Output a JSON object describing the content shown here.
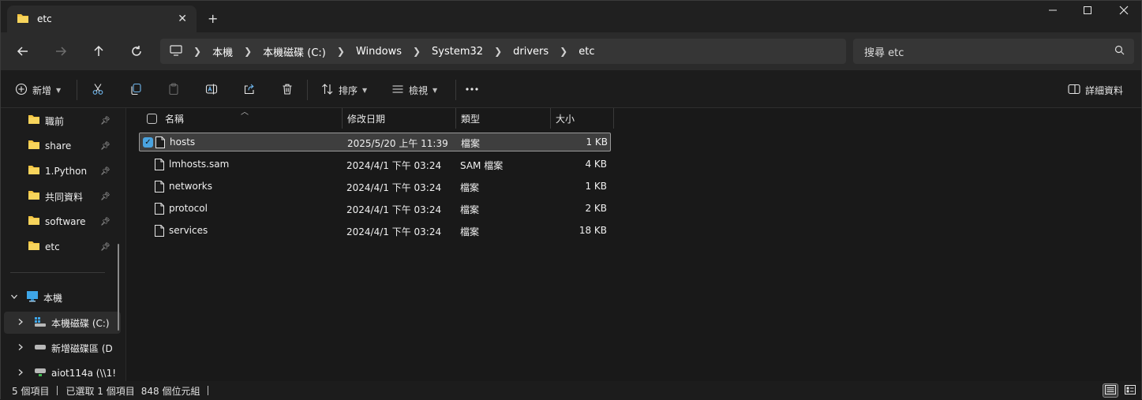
{
  "window": {
    "tab_label": "etc",
    "new_tab_glyph": "+",
    "close_tab_glyph": "✕"
  },
  "navigation": {
    "breadcrumbs": [
      "本機",
      "本機磁碟 (C:)",
      "Windows",
      "System32",
      "drivers",
      "etc"
    ],
    "search_placeholder": "搜尋 etc"
  },
  "command_bar": {
    "new_label": "新增",
    "sort_label": "排序",
    "view_label": "檢視",
    "details_label": "詳細資料"
  },
  "sidebar": {
    "pinned": [
      {
        "label": "職前",
        "icon": "folder-icon",
        "pinned": true
      },
      {
        "label": "share",
        "icon": "folder-icon",
        "pinned": true
      },
      {
        "label": "1.Python",
        "icon": "folder-icon",
        "pinned": true
      },
      {
        "label": "共同資料",
        "icon": "folder-icon",
        "pinned": true
      },
      {
        "label": "software",
        "icon": "folder-icon",
        "pinned": true
      },
      {
        "label": "etc",
        "icon": "folder-icon",
        "pinned": true
      }
    ],
    "this_pc": {
      "label": "本機",
      "expanded": true
    },
    "drives": [
      {
        "label": "本機磁碟 (C:)",
        "selected": true
      },
      {
        "label": "新增磁碟區 (D"
      },
      {
        "label": "aiot114a (\\\\1!"
      }
    ]
  },
  "file_list": {
    "columns": {
      "name": "名稱",
      "modified": "修改日期",
      "type": "類型",
      "size": "大小"
    },
    "rows": [
      {
        "name": "hosts",
        "modified": "2025/5/20 上午 11:39",
        "type": "檔案",
        "size": "1 KB",
        "selected": true
      },
      {
        "name": "lmhosts.sam",
        "modified": "2024/4/1 下午 03:24",
        "type": "SAM 檔案",
        "size": "4 KB",
        "selected": false
      },
      {
        "name": "networks",
        "modified": "2024/4/1 下午 03:24",
        "type": "檔案",
        "size": "1 KB",
        "selected": false
      },
      {
        "name": "protocol",
        "modified": "2024/4/1 下午 03:24",
        "type": "檔案",
        "size": "2 KB",
        "selected": false
      },
      {
        "name": "services",
        "modified": "2024/4/1 下午 03:24",
        "type": "檔案",
        "size": "18 KB",
        "selected": false
      }
    ]
  },
  "status_bar": {
    "item_count": "5 個項目",
    "selection": "已選取 1 個項目",
    "selection_size": "848 個位元組"
  },
  "colors": {
    "accent": "#4aa3df",
    "folder": "#f4c542",
    "window_bg": "#1c1c1c"
  }
}
